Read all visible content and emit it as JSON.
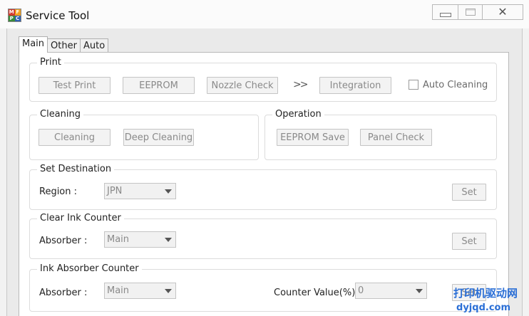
{
  "window": {
    "title": "Service Tool",
    "icon_letters": [
      "M",
      "F",
      "P",
      "C"
    ]
  },
  "tabs": [
    {
      "label": "Main",
      "active": true
    },
    {
      "label": "Other",
      "active": false
    },
    {
      "label": "Auto",
      "active": false
    }
  ],
  "print_group": {
    "title": "Print",
    "test_print": "Test Print",
    "eeprom": "EEPROM",
    "nozzle_check": "Nozzle Check",
    "arrows": ">>",
    "integration": "Integration",
    "auto_cleaning": "Auto Cleaning"
  },
  "cleaning_group": {
    "title": "Cleaning",
    "cleaning": "Cleaning",
    "deep_cleaning": "Deep Cleaning"
  },
  "operation_group": {
    "title": "Operation",
    "eeprom_save": "EEPROM Save",
    "panel_check": "Panel Check"
  },
  "set_destination": {
    "title": "Set Destination",
    "region_label": "Region :",
    "region_value": "JPN",
    "set": "Set"
  },
  "clear_ink_counter": {
    "title": "Clear Ink Counter",
    "absorber_label": "Absorber :",
    "absorber_value": "Main",
    "set": "Set"
  },
  "ink_absorber_counter": {
    "title": "Ink Absorber Counter",
    "absorber_label": "Absorber :",
    "absorber_value": "Main",
    "counter_label": "Counter Value(%)",
    "counter_value": "0",
    "set": "Set"
  },
  "watermark": {
    "text": "打印机驱动网",
    "domain": "dyjqd.com"
  },
  "colors": {
    "watermark": "#2b6fd6",
    "disabled_text": "#8a8a8a"
  }
}
